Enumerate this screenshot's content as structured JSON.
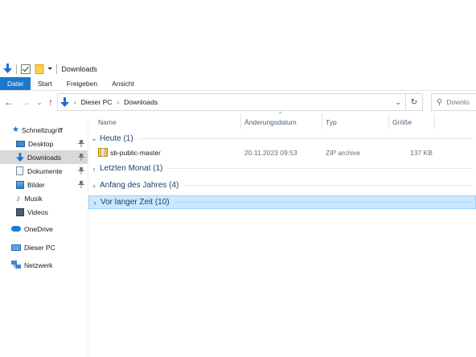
{
  "titlebar": {
    "title": "Downloads"
  },
  "ribbon": {
    "tabs": [
      "Datei",
      "Start",
      "Freigeben",
      "Ansicht"
    ]
  },
  "address": {
    "crumbs": [
      "Dieser PC",
      "Downloads"
    ]
  },
  "search": {
    "placeholder": "Downlo"
  },
  "navpane": {
    "quick_access": "Schnellzugriff",
    "items": [
      {
        "label": "Desktop",
        "icon": "desktop-icon",
        "pinned": true
      },
      {
        "label": "Downloads",
        "icon": "downloads-icon",
        "pinned": true,
        "active": true
      },
      {
        "label": "Dokumente",
        "icon": "documents-icon",
        "pinned": true
      },
      {
        "label": "Bilder",
        "icon": "pictures-icon",
        "pinned": true
      },
      {
        "label": "Musik",
        "icon": "music-icon"
      },
      {
        "label": "Videos",
        "icon": "videos-icon"
      }
    ],
    "onedrive": "OneDrive",
    "this_pc": "Dieser PC",
    "network": "Netzwerk"
  },
  "columns": {
    "name": "Name",
    "modified": "Änderungsdatum",
    "type": "Typ",
    "size": "Größe"
  },
  "groups": [
    {
      "label": "Heute (1)",
      "expanded": true
    },
    {
      "label": "Letzten Monat (1)",
      "expanded": false
    },
    {
      "label": "Anfang des Jahres (4)",
      "expanded": false
    },
    {
      "label": "Vor langer Zeit (10)",
      "expanded": false,
      "selected": true
    }
  ],
  "files": [
    {
      "name": "sb-public-master",
      "modified": "20.11.2023 09:53",
      "type": "ZIP archive",
      "size": "137 KB"
    }
  ],
  "colors": {
    "accent": "#1979ca",
    "selection": "#cce8ff",
    "group_text": "#1e3f6e",
    "header_text": "#4c607a"
  }
}
